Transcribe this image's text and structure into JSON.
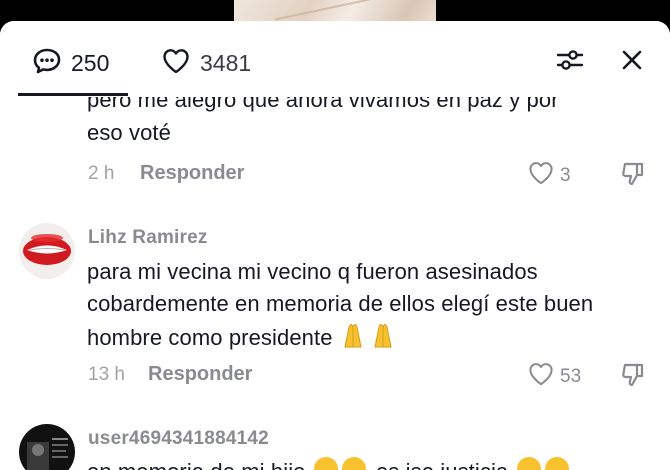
{
  "header": {
    "comment_count": "250",
    "like_count": "3481"
  },
  "comments": [
    {
      "text_line1": "pero me alegro que ahora vivamos en paz y por",
      "text_line2": "eso voté",
      "time": "2 h",
      "reply_label": "Responder",
      "likes": "3"
    },
    {
      "username": "Lihz Ramirez",
      "text_line1": "para mi vecina mi vecino q fueron asesinados",
      "text_line2": "cobardemente en memoria de ellos elegí este buen",
      "text_line3": "hombre como presidente",
      "time": "13 h",
      "reply_label": "Responder",
      "likes": "53"
    },
    {
      "username": "user4694341884142",
      "text_partial": "en memoria de mi hijo",
      "text_partial2": "es ise justicia"
    }
  ],
  "colors": {
    "text": "#161823",
    "muted": "#8a8b91",
    "emoji_yellow": "#f7c22e"
  }
}
